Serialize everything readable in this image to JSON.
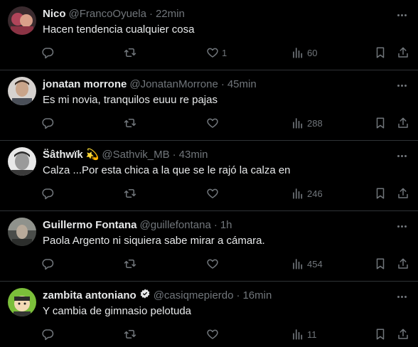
{
  "tweets": [
    {
      "name": "Nico",
      "handle": "@FrancoOyuela",
      "time": "22min",
      "text": "Hacen tendencia cualquier cosa",
      "likes": "1",
      "views": "60",
      "avatar_color": "#b0455a",
      "badge": ""
    },
    {
      "name": "jonatan morrone",
      "handle": "@JonatanMorrone",
      "time": "45min",
      "text": "Es mi novia, tranquilos euuu re pajas",
      "likes": "",
      "views": "288",
      "avatar_color": "#c9a48a",
      "badge": ""
    },
    {
      "name": "S̈âthwïk",
      "handle": "@Sathvik_MB",
      "time": "43min",
      "text": "Calza ...Por esta chica a la que se le rajó la calza en",
      "likes": "",
      "views": "246",
      "avatar_color": "#d8d8d8",
      "badge": "💫"
    },
    {
      "name": "Guillermo Fontana",
      "handle": "@guillefontana",
      "time": "1h",
      "text": "Paola Argento ni siquiera sabe mirar a cámara.",
      "likes": "",
      "views": "454",
      "avatar_color": "#6b6f6a",
      "badge": ""
    },
    {
      "name": "zambita antoniano",
      "handle": "@casiqmepierdo",
      "time": "16min",
      "text": "Y cambia de gimnasio pelotuda",
      "likes": "",
      "views": "11",
      "avatar_color": "#7bbf3a",
      "badge": "verified"
    }
  ],
  "separator": "·",
  "colors": {
    "background": "#000000",
    "text": "#e7e9ea",
    "muted": "#71767b",
    "divider": "#2f3336"
  },
  "icons": [
    "reply-icon",
    "retweet-icon",
    "like-icon",
    "views-icon",
    "bookmark-icon",
    "share-icon",
    "more-icon",
    "verified-icon"
  ]
}
